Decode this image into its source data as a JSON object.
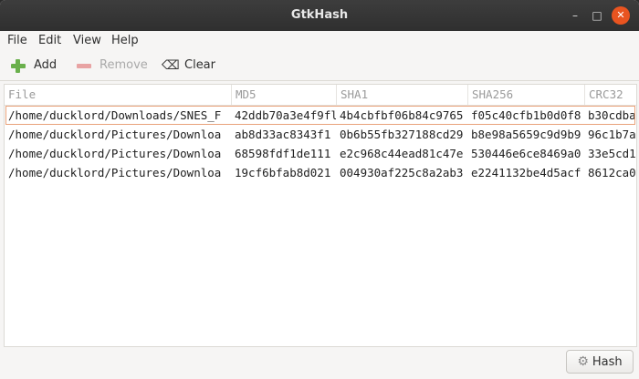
{
  "window": {
    "title": "GtkHash",
    "controls": {
      "minimize": "–",
      "maximize": "□",
      "close": "✕"
    }
  },
  "menu": [
    "File",
    "Edit",
    "View",
    "Help"
  ],
  "toolbar": {
    "add_label": "Add",
    "remove_label": "Remove",
    "clear_label": "Clear"
  },
  "table": {
    "columns": [
      "File",
      "MD5",
      "SHA1",
      "SHA256",
      "CRC32"
    ],
    "rows": [
      [
        "/home/ducklord/Downloads/SNES_F",
        "42ddb70a3e4f9fl",
        "4b4cbfbf06b84c9765",
        "f05c40cfb1b0d0f8",
        "b30cdba"
      ],
      [
        "/home/ducklord/Pictures/Downloa",
        "ab8d33ac8343f1",
        "0b6b55fb327188cd29",
        "b8e98a5659c9d9b9",
        "96c1b7a"
      ],
      [
        "/home/ducklord/Pictures/Downloa",
        "68598fdf1de111",
        "e2c968c44ead81c47e",
        "530446e6ce8469a0",
        "33e5cd1"
      ],
      [
        "/home/ducklord/Pictures/Downloa",
        "19cf6bfab8d021",
        "004930af225c8a2ab3",
        "e2241132be4d5acf",
        "8612ca0"
      ]
    ],
    "selected_row": 0
  },
  "footer": {
    "hash_label": "Hash"
  },
  "colors": {
    "titlebar": "#353535",
    "selection_border": "#e9a27a",
    "add_icon": "#6ab04c",
    "remove_icon": "#e8a3a3",
    "close_button": "#e95420"
  },
  "icons": {
    "add": "plus-icon",
    "remove": "minus-icon",
    "clear": "clear-icon",
    "hash": "gear-icon"
  }
}
